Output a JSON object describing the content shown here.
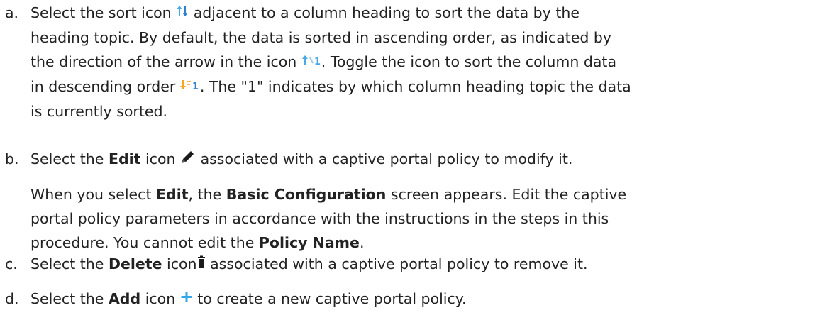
{
  "items": [
    {
      "marker": "a.",
      "line1_a": "Select the sort icon",
      "line1_b": "adjacent to a column heading to sort the data by the",
      "line2": "heading topic. By default, the data is sorted in ascending order, as indicated by",
      "line3_a": "the direction of the arrow in the icon",
      "line3_b": ". Toggle the icon to sort the column data",
      "line4_a": "in descending order",
      "line4_b": ". The \"1\" indicates by which column heading topic the data",
      "line5": "is currently sorted."
    },
    {
      "marker": "b.",
      "p1_a": "Select the",
      "p1_bold": "Edit",
      "p1_b": "icon",
      "p1_c": "associated with a captive portal policy to modify it.",
      "p2_a": "When you select",
      "p2_bold1": "Edit",
      "p2_b": ", the",
      "p2_bold2": "Basic Configuration",
      "p2_c": "screen appears. Edit the captive",
      "p2_line2": "portal policy parameters in accordance with the instructions in the steps in this",
      "p2_line3_a": "procedure. You cannot edit the",
      "p2_bold3": "Policy Name",
      "p2_line3_b": "."
    },
    {
      "marker": "c.",
      "a": "Select the",
      "bold": "Delete",
      "b": "icon",
      "c": "associated with a captive portal policy to remove it."
    },
    {
      "marker": "d.",
      "a": "Select the",
      "bold": "Add",
      "b": "icon",
      "c": "to create a new captive portal policy."
    }
  ],
  "icon_colors": {
    "sort_up": "#49a9e8",
    "sort_down": "#2f7fd1",
    "sort_asc": "#49a9e8",
    "sort_desc": "#f5a623",
    "edit": "#1a1a1a",
    "delete": "#1a1a1a",
    "add": "#35a6e6"
  },
  "icons": [
    "sort-icon",
    "sort-ascending-icon",
    "sort-descending-icon",
    "pencil-icon",
    "trash-icon",
    "plus-icon"
  ],
  "sort_icon_digit": "1"
}
